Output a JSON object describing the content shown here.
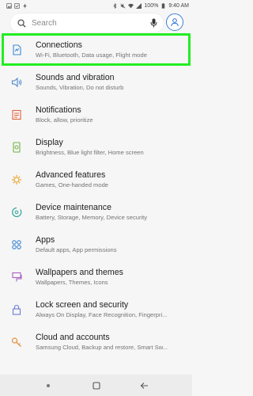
{
  "status_bar": {
    "battery": "100%",
    "time": "9:40 AM"
  },
  "search": {
    "placeholder": "Search"
  },
  "settings": [
    {
      "title": "Connections",
      "subtitle": "Wi-Fi, Bluetooth, Data usage, Flight mode",
      "icon": "connections-icon"
    },
    {
      "title": "Sounds and vibration",
      "subtitle": "Sounds, Vibration, Do not disturb",
      "icon": "sound-icon"
    },
    {
      "title": "Notifications",
      "subtitle": "Block, allow, prioritize",
      "icon": "notifications-icon"
    },
    {
      "title": "Display",
      "subtitle": "Brightness, Blue light filter, Home screen",
      "icon": "display-icon"
    },
    {
      "title": "Advanced features",
      "subtitle": "Games, One-handed mode",
      "icon": "advanced-features-icon"
    },
    {
      "title": "Device maintenance",
      "subtitle": "Battery, Storage, Memory, Device security",
      "icon": "device-maintenance-icon"
    },
    {
      "title": "Apps",
      "subtitle": "Default apps, App permissions",
      "icon": "apps-icon"
    },
    {
      "title": "Wallpapers and themes",
      "subtitle": "Wallpapers, Themes, Icons",
      "icon": "wallpapers-icon"
    },
    {
      "title": "Lock screen and security",
      "subtitle": "Always On Display, Face Recognition, Fingerpri...",
      "icon": "lock-icon"
    },
    {
      "title": "Cloud and accounts",
      "subtitle": "Samsung Cloud, Backup and restore, Smart Sw...",
      "icon": "key-icon"
    }
  ],
  "colors": {
    "accent": "#3e7fd6",
    "highlight": "#22ee22"
  }
}
